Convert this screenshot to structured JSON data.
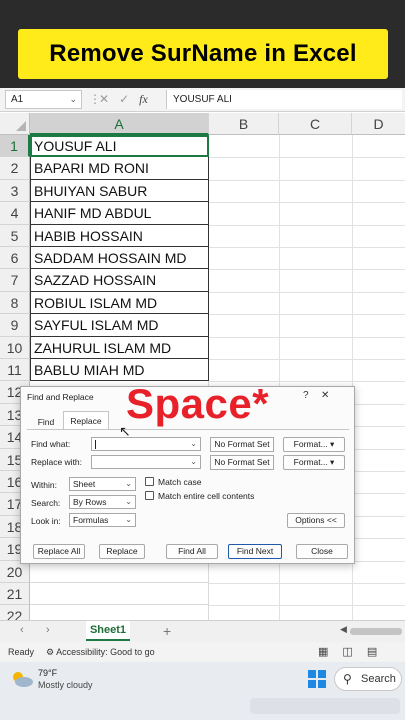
{
  "banner": {
    "title": "Remove SurName in Excel"
  },
  "formula_bar": {
    "name_box": "A1",
    "fx_label": "fx",
    "content": "YOUSUF ALI"
  },
  "columns": [
    "A",
    "B",
    "C",
    "D"
  ],
  "rows": [
    "1",
    "2",
    "3",
    "4",
    "5",
    "6",
    "7",
    "8",
    "9",
    "10",
    "11",
    "12",
    "13",
    "14",
    "15",
    "16",
    "17",
    "18",
    "19",
    "20",
    "21",
    "22"
  ],
  "cells": [
    "YOUSUF ALI",
    "BAPARI MD RONI",
    "BHUIYAN SABUR",
    "HANIF MD ABDUL",
    "HABIB HOSSAIN",
    "SADDAM HOSSAIN MD",
    "SAZZAD HOSSAIN",
    "ROBIUL ISLAM MD",
    "SAYFUL ISLAM MD",
    "ZAHURUL ISLAM MD",
    "BABLU MIAH MD"
  ],
  "sheet_tabs": {
    "active": "Sheet1",
    "add": "+"
  },
  "status_bar": {
    "ready": "Ready",
    "accessibility": "Accessibility: Good to go"
  },
  "dialog": {
    "title": "Find and Replace",
    "tabs": [
      "Find",
      "Replace"
    ],
    "find_what_label": "Find what:",
    "find_what_value": "",
    "replace_with_label": "Replace with:",
    "replace_with_value": "",
    "no_format_set": "No Format Set",
    "format_button": "Format...",
    "within_label": "Within:",
    "within_value": "Sheet",
    "search_label": "Search:",
    "search_value": "By Rows",
    "look_in_label": "Look in:",
    "look_in_value": "Formulas",
    "match_case": "Match case",
    "match_entire": "Match entire cell contents",
    "options_button": "Options <<",
    "replace_all": "Replace All",
    "replace": "Replace",
    "find_all": "Find All",
    "find_next": "Find Next",
    "close": "Close"
  },
  "overlay_text": "Space*",
  "taskbar": {
    "temperature": "79°F",
    "weather": "Mostly cloudy",
    "search": "Search"
  }
}
